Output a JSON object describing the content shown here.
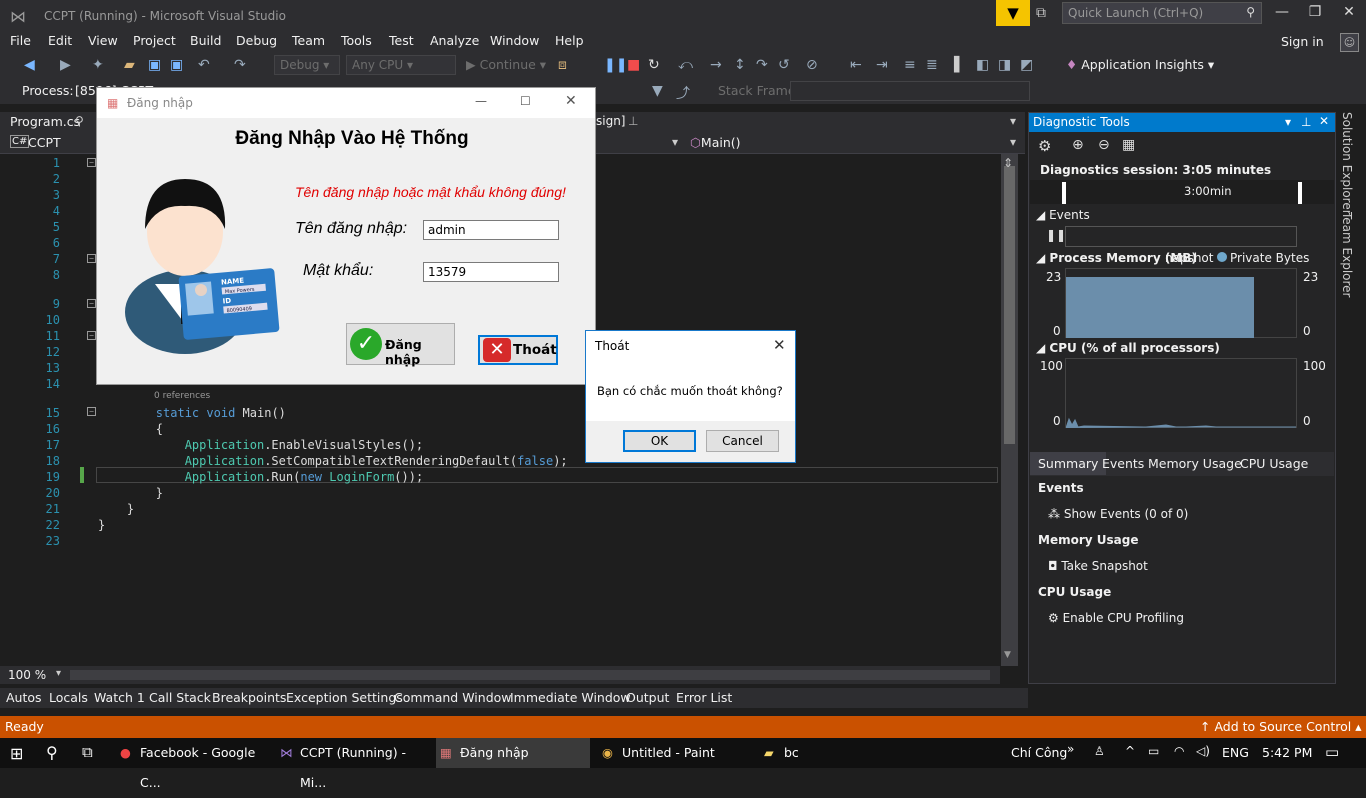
{
  "window": {
    "title": "CCPT (Running) - Microsoft Visual Studio"
  },
  "quick_launch": {
    "placeholder": "Quick Launch (Ctrl+Q)"
  },
  "menu": [
    "File",
    "Edit",
    "View",
    "Project",
    "Build",
    "Debug",
    "Team",
    "Tools",
    "Test",
    "Analyze",
    "Window",
    "Help"
  ],
  "signin_label": "Sign in",
  "toolbar": {
    "config": "Debug",
    "platform": "Any CPU",
    "continue": "Continue",
    "app_insights": "Application Insights"
  },
  "toolbar2": {
    "process_label": "Process:",
    "process_value": "[8596] CCPT",
    "stack_frame_label": "Stack Frame:"
  },
  "editor": {
    "tabs": [
      "Program.cs",
      "sign]"
    ],
    "nav_left": "CCPT",
    "nav_right": "Main()",
    "zoom": "100 %",
    "lines": [
      {
        "n": "1",
        "text": ""
      },
      {
        "n": "2",
        "text": ""
      },
      {
        "n": "3",
        "text": ""
      },
      {
        "n": "4",
        "text": ""
      },
      {
        "n": "5",
        "text": ""
      },
      {
        "n": "6",
        "text": ""
      },
      {
        "n": "7",
        "text": ""
      },
      {
        "n": "8",
        "text": ""
      },
      {
        "n": "9",
        "text": ""
      },
      {
        "n": "10",
        "text": ""
      },
      {
        "n": "11",
        "text": ""
      },
      {
        "n": "12",
        "text": ""
      },
      {
        "n": "13",
        "text": ""
      },
      {
        "n": "14",
        "text": ""
      },
      {
        "n": "15",
        "text": "        static void Main()"
      },
      {
        "n": "16",
        "text": "        {"
      },
      {
        "n": "17",
        "text": "            Application.EnableVisualStyles();"
      },
      {
        "n": "18",
        "text": "            Application.SetCompatibleTextRenderingDefault(false);"
      },
      {
        "n": "19",
        "text": "            Application.Run(new LoginForm());"
      },
      {
        "n": "20",
        "text": "        }"
      },
      {
        "n": "21",
        "text": "    }"
      },
      {
        "n": "22",
        "text": "}"
      },
      {
        "n": "23",
        "text": ""
      }
    ],
    "references": "0 references"
  },
  "bottom_tabs": [
    "Autos",
    "Locals",
    "Watch 1",
    "Call Stack",
    "Breakpoints",
    "Exception Settings",
    "Command Window",
    "Immediate Window",
    "Output",
    "Error List"
  ],
  "status": {
    "left": "Ready",
    "right": "Add to Source Control"
  },
  "diagnostic": {
    "title": "Diagnostic Tools",
    "session": "Diagnostics session: 3:05 minutes",
    "timeline_label": "3:00min",
    "events_label": "Events",
    "memory_label": "Process Memory (MB)",
    "snapshot_label": "napshot",
    "private_bytes": "Private Bytes",
    "mem_max": "23",
    "mem_min": "0",
    "cpu_label": "CPU (% of all processors)",
    "cpu_max": "100",
    "cpu_min": "0",
    "tabs": [
      "Summary",
      "Events",
      "Memory Usage",
      "CPU Usage"
    ],
    "sections": [
      {
        "header": "Events",
        "action": "Show Events (0 of 0)"
      },
      {
        "header": "Memory Usage",
        "action": "Take Snapshot"
      },
      {
        "header": "CPU Usage",
        "action": "Enable CPU Profiling"
      }
    ]
  },
  "side_tabs": [
    "Solution Explorer",
    "Team Explorer"
  ],
  "login_form": {
    "title": "Đăng nhập",
    "heading": "Đăng Nhập Vào Hệ Thống",
    "error": "Tên đăng nhập hoặc mật khẩu không đúng!",
    "user_label": "Tên đăng nhập:",
    "user_value": "admin",
    "pass_label": "Mật khẩu:",
    "pass_value": "13579",
    "login_button": "Đăng nhập",
    "exit_button": "Thoát",
    "card_name": "NAME",
    "card_name_value": "Max Powers",
    "card_id": "ID",
    "card_id_value": "80090409"
  },
  "confirm_dialog": {
    "title": "Thoát",
    "message": "Bạn có chắc muốn thoát không?",
    "ok": "OK",
    "cancel": "Cancel"
  },
  "taskbar": {
    "apps": [
      "Facebook - Google C...",
      "CCPT (Running) - Mi...",
      "Đăng nhập",
      "Untitled - Paint",
      "bc"
    ],
    "user": "Chí Công",
    "lang": "ENG",
    "time": "5:42 PM"
  }
}
